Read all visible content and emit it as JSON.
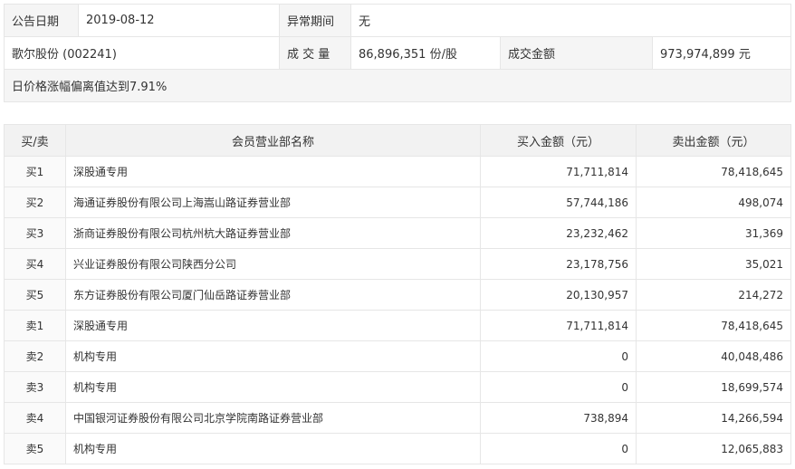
{
  "summary": {
    "announce_label": "公告日期",
    "announce_date": "2019-08-12",
    "abnormal_label": "异常期间",
    "abnormal_value": "无",
    "stock_name": "歌尔股份 (002241)",
    "volume_label": "成 交 量",
    "volume_value": "86,896,351 份/股",
    "amount_label": "成交金额",
    "amount_value": "973,974,899 元",
    "reason": "日价格涨幅偏离值达到7.91%"
  },
  "detail": {
    "headers": [
      "买/卖",
      "会员营业部名称",
      "买入金额（元）",
      "卖出金额（元）"
    ],
    "rows": [
      {
        "side": "买1",
        "name": "深股通专用",
        "buy": "71,711,814",
        "sell": "78,418,645"
      },
      {
        "side": "买2",
        "name": "海通证券股份有限公司上海嵩山路证券营业部",
        "buy": "57,744,186",
        "sell": "498,074"
      },
      {
        "side": "买3",
        "name": "浙商证券股份有限公司杭州杭大路证券营业部",
        "buy": "23,232,462",
        "sell": "31,369"
      },
      {
        "side": "买4",
        "name": "兴业证券股份有限公司陕西分公司",
        "buy": "23,178,756",
        "sell": "35,021"
      },
      {
        "side": "买5",
        "name": "东方证券股份有限公司厦门仙岳路证券营业部",
        "buy": "20,130,957",
        "sell": "214,272"
      },
      {
        "side": "卖1",
        "name": "深股通专用",
        "buy": "71,711,814",
        "sell": "78,418,645"
      },
      {
        "side": "卖2",
        "name": "机构专用",
        "buy": "0",
        "sell": "40,048,486"
      },
      {
        "side": "卖3",
        "name": "机构专用",
        "buy": "0",
        "sell": "18,699,574"
      },
      {
        "side": "卖4",
        "name": "中国银河证券股份有限公司北京学院南路证券营业部",
        "buy": "738,894",
        "sell": "14,266,594"
      },
      {
        "side": "卖5",
        "name": "机构专用",
        "buy": "0",
        "sell": "12,065,883"
      }
    ]
  }
}
